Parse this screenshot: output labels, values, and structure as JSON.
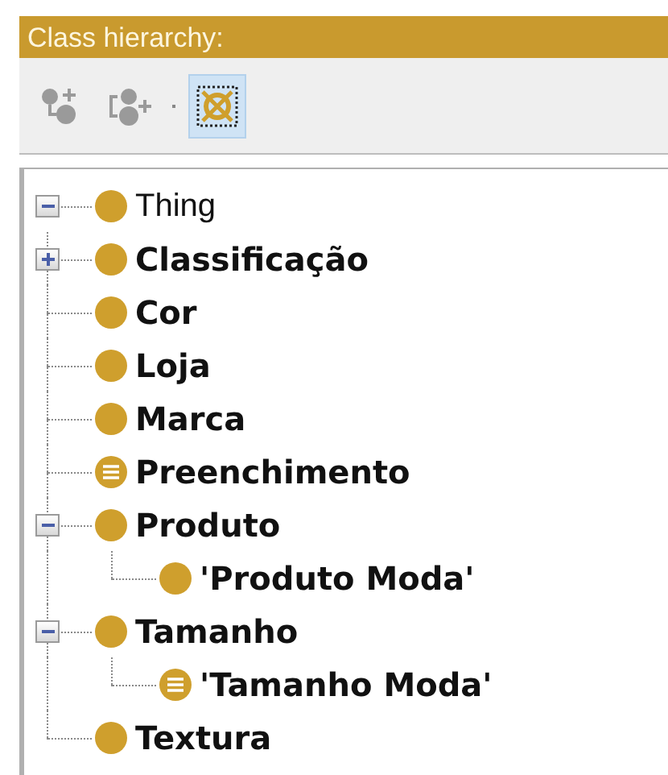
{
  "panel": {
    "title": "Class hierarchy:"
  },
  "toolbar": [
    {
      "kind": "add-subclass",
      "disabled": true,
      "selected": false
    },
    {
      "kind": "add-sibling",
      "disabled": true,
      "selected": false
    },
    {
      "kind": "delete",
      "disabled": false,
      "selected": true
    }
  ],
  "tree": [
    {
      "label": "Thing",
      "kind": "class",
      "bold": false,
      "expanded": true,
      "children": [
        {
          "label": "Classificação",
          "kind": "class",
          "bold": true,
          "expanded": false
        },
        {
          "label": "Cor",
          "kind": "class",
          "bold": true
        },
        {
          "label": "Loja",
          "kind": "class",
          "bold": true
        },
        {
          "label": "Marca",
          "kind": "class",
          "bold": true
        },
        {
          "label": "Preenchimento",
          "kind": "defined",
          "bold": true
        },
        {
          "label": "Produto",
          "kind": "class",
          "bold": true,
          "expanded": true,
          "children": [
            {
              "label": "'Produto Moda'",
              "kind": "class",
              "bold": true
            }
          ]
        },
        {
          "label": "Tamanho",
          "kind": "class",
          "bold": true,
          "expanded": true,
          "children": [
            {
              "label": "'Tamanho Moda'",
              "kind": "defined",
              "bold": true
            }
          ]
        },
        {
          "label": "Textura",
          "kind": "class",
          "bold": true
        }
      ]
    }
  ]
}
